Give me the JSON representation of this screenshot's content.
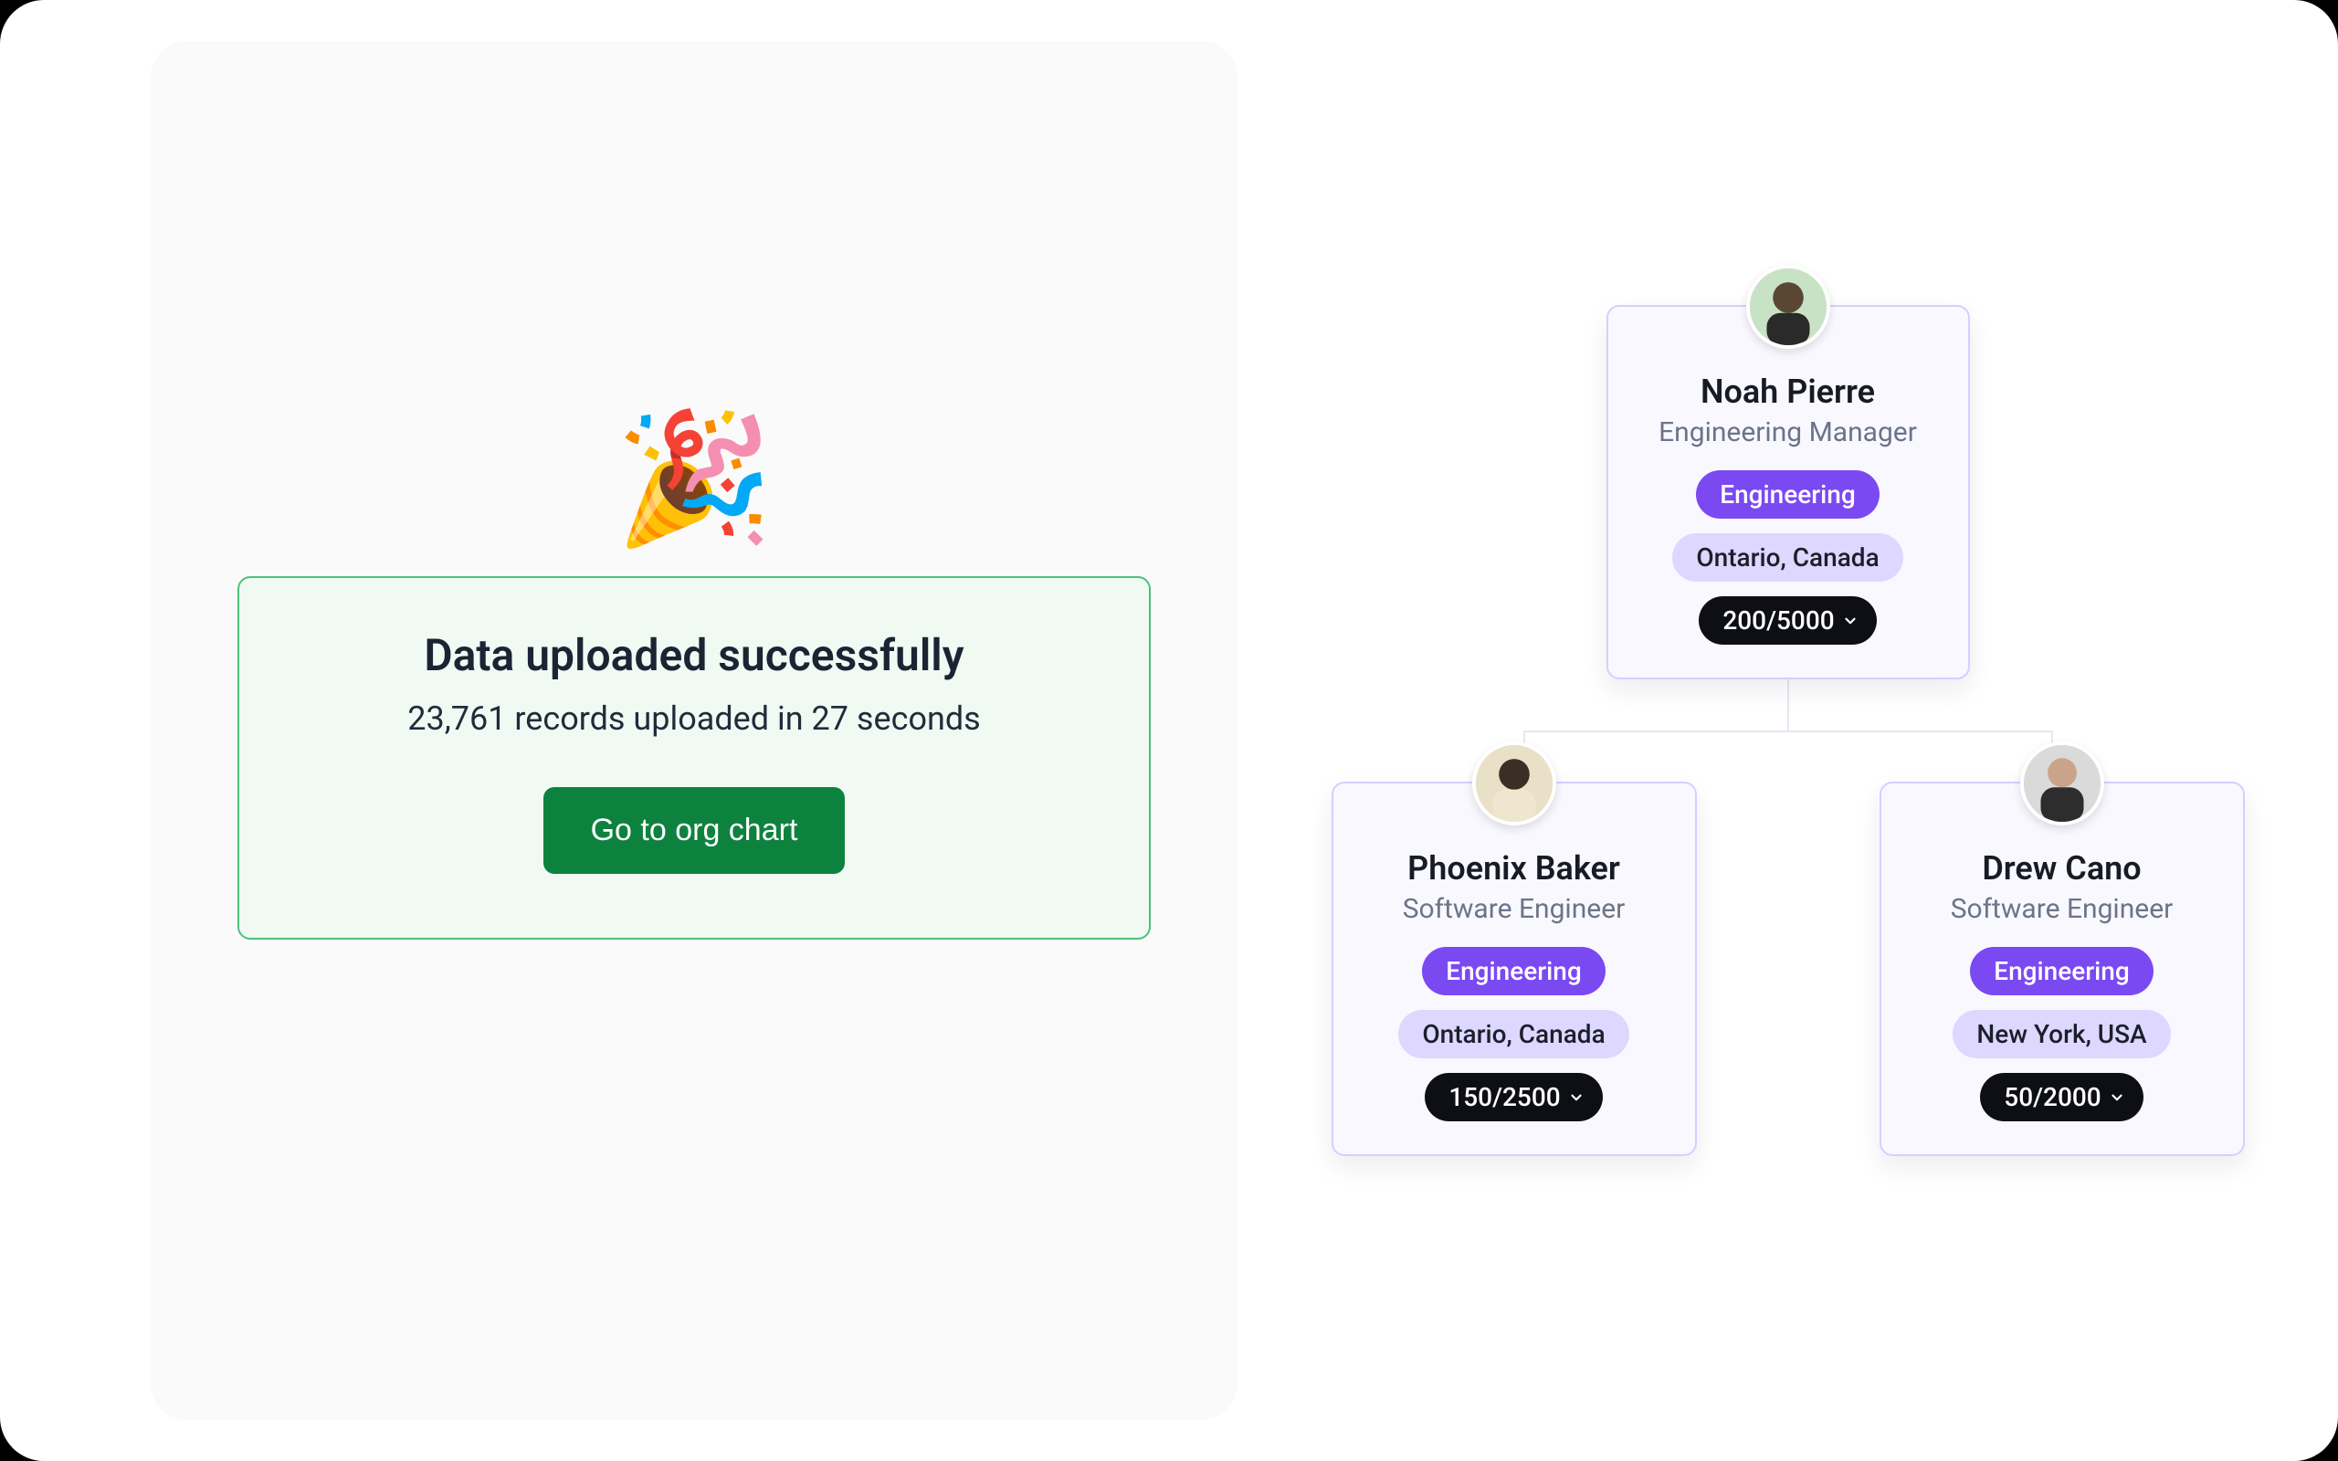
{
  "success": {
    "emoji": "🎉",
    "title": "Data uploaded successfully",
    "subtitle": "23,761 records uploaded in 27 seconds",
    "cta_label": "Go to org chart"
  },
  "org": {
    "root": {
      "name": "Noah Pierre",
      "title": "Engineering Manager",
      "department": "Engineering",
      "location": "Ontario, Canada",
      "ratio": "200/5000"
    },
    "children": [
      {
        "name": "Phoenix Baker",
        "title": "Software Engineer",
        "department": "Engineering",
        "location": "Ontario, Canada",
        "ratio": "150/2500"
      },
      {
        "name": "Drew Cano",
        "title": "Software Engineer",
        "department": "Engineering",
        "location": "New York, USA",
        "ratio": "50/2000"
      }
    ]
  }
}
